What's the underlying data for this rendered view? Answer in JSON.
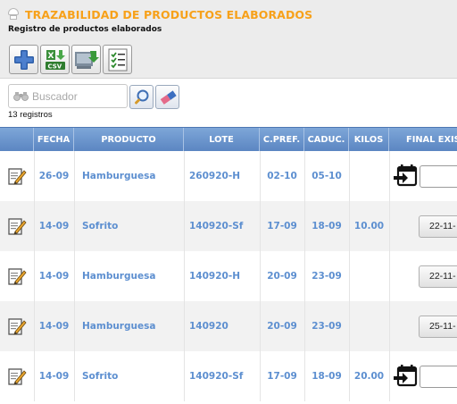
{
  "header": {
    "title": "TRAZABILIDAD DE PRODUCTOS ELABORADOS",
    "subtitle": "Registro de productos elaborados",
    "title_color": "#f7a11a"
  },
  "toolbar": {
    "buttons": [
      {
        "name": "add-button",
        "icon": "plus-icon"
      },
      {
        "name": "export-csv-button",
        "icon": "csv-download-icon",
        "label": "CSV"
      },
      {
        "name": "import-button",
        "icon": "import-screen-icon"
      },
      {
        "name": "checklist-button",
        "icon": "checklist-icon"
      }
    ]
  },
  "search": {
    "placeholder": "Buscador",
    "records_label": "13 registros"
  },
  "table": {
    "header_color": "#5b86c2",
    "value_color": "#5d8fd0",
    "columns": [
      "FECHA",
      "PRODUCTO",
      "LOTE",
      "C.PREF.",
      "CADUC.",
      "KILOS",
      "FINAL EXIS"
    ],
    "rows": [
      {
        "fecha": "26-09",
        "producto": "Hamburguesa",
        "lote": "260920-H",
        "cpref": "02-10",
        "caduc": "05-10",
        "kilos": "",
        "final": "",
        "final_mode": "input"
      },
      {
        "fecha": "14-09",
        "producto": "Sofrito",
        "lote": "140920-Sf",
        "cpref": "17-09",
        "caduc": "18-09",
        "kilos": "10.00",
        "final": "22-11-",
        "final_mode": "date"
      },
      {
        "fecha": "14-09",
        "producto": "Hamburguesa",
        "lote": "140920-H",
        "cpref": "20-09",
        "caduc": "23-09",
        "kilos": "",
        "final": "22-11-",
        "final_mode": "date"
      },
      {
        "fecha": "14-09",
        "producto": "Hamburguesa",
        "lote": "140920",
        "cpref": "20-09",
        "caduc": "23-09",
        "kilos": "",
        "final": "25-11-",
        "final_mode": "date"
      },
      {
        "fecha": "14-09",
        "producto": "Sofrito",
        "lote": "140920-Sf",
        "cpref": "17-09",
        "caduc": "18-09",
        "kilos": "20.00",
        "final": "",
        "final_mode": "input"
      }
    ]
  }
}
